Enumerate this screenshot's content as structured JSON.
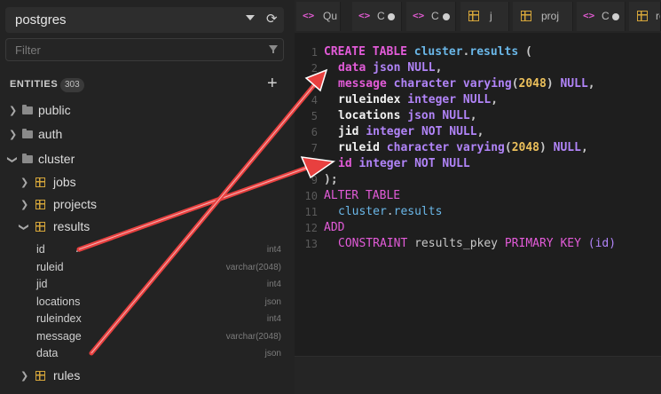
{
  "sidebar": {
    "database": "postgres",
    "filter_placeholder": "Filter",
    "entities_label": "ENTITIES",
    "entities_count": "303",
    "schemas": {
      "public": "public",
      "auth": "auth",
      "cluster": "cluster"
    },
    "tables": {
      "jobs": "jobs",
      "projects": "projects",
      "results": "results",
      "rules": "rules"
    },
    "columns": [
      {
        "name": "id",
        "type": "int4"
      },
      {
        "name": "ruleid",
        "type": "varchar(2048)"
      },
      {
        "name": "jid",
        "type": "int4"
      },
      {
        "name": "locations",
        "type": "json"
      },
      {
        "name": "ruleindex",
        "type": "int4"
      },
      {
        "name": "message",
        "type": "varchar(2048)"
      },
      {
        "name": "data",
        "type": "json"
      }
    ]
  },
  "tabs": [
    {
      "icon": "code-icon",
      "title": "Qu",
      "dirty": false
    },
    {
      "icon": "code-icon",
      "title": "C",
      "dirty": true
    },
    {
      "icon": "code-icon",
      "title": "C",
      "dirty": true
    },
    {
      "icon": "table-icon",
      "title": "j",
      "dirty": false
    },
    {
      "icon": "table-icon",
      "title": "proj",
      "dirty": false
    },
    {
      "icon": "code-icon",
      "title": "C",
      "dirty": true
    },
    {
      "icon": "table-icon",
      "title": "re",
      "dirty": false
    }
  ],
  "editor": {
    "line_numbers": [
      "1",
      "2",
      "3",
      "4",
      "5",
      "6",
      "7",
      "8",
      "9",
      "10",
      "11",
      "12",
      "13"
    ],
    "l1": {
      "create": "CREATE TABLE ",
      "schema": "cluster",
      "dot": ".",
      "table": "results",
      "paren": " ("
    },
    "l2": {
      "name": "data ",
      "type": "json ",
      "null": "NULL",
      "end": ","
    },
    "l3": {
      "name": "message ",
      "type": "character varying",
      "open": "(",
      "num": "2048",
      "close": ") ",
      "null": "NULL",
      "end": ","
    },
    "l4": {
      "name": "ruleindex ",
      "type": "integer ",
      "null": "NULL",
      "end": ","
    },
    "l5": {
      "name": "locations ",
      "type": "json ",
      "null": "NULL",
      "end": ","
    },
    "l6": {
      "name": "jid ",
      "type": "integer ",
      "null": "NOT NULL",
      "end": ","
    },
    "l7": {
      "name": "ruleid ",
      "type": "character varying",
      "open": "(",
      "num": "2048",
      "close": ") ",
      "null": "NULL",
      "end": ","
    },
    "l8": {
      "name": "id ",
      "type": "integer ",
      "null": "NOT NULL"
    },
    "l9": {
      "text": ");"
    },
    "l10": {
      "text": "ALTER TABLE"
    },
    "l11": {
      "schema": "cluster",
      "dot": ".",
      "table": "results"
    },
    "l12": {
      "text": "ADD"
    },
    "l13": {
      "constraint": "CONSTRAINT ",
      "name": "results_pkey ",
      "pk": "PRIMARY KEY ",
      "cols": "(id)"
    }
  },
  "colors": {
    "keyword": "#e25bd8",
    "type": "#b184f8",
    "number": "#ecc05b",
    "table_icon": "#d4a53a",
    "annotation_arrow": "#e8403f"
  }
}
